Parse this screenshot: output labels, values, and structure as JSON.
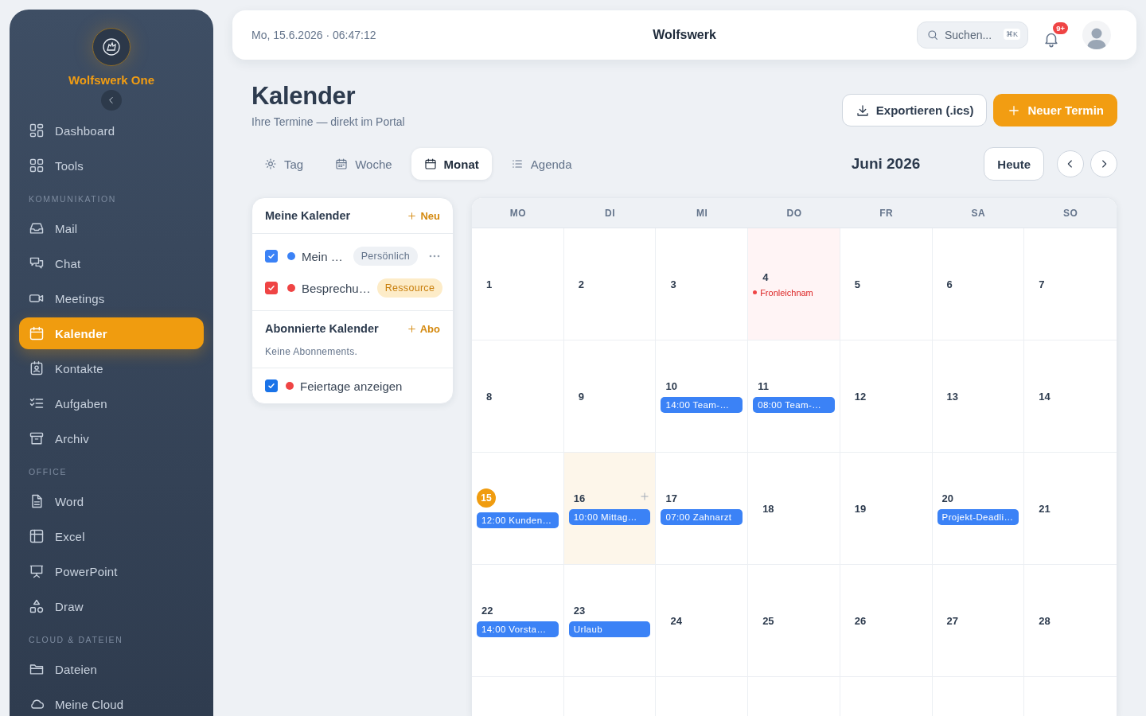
{
  "sidebar": {
    "brand": "Wolfswerk One",
    "sections": [
      {
        "items": [
          {
            "label": "Dashboard",
            "selected": false
          },
          {
            "label": "Tools",
            "selected": false
          }
        ]
      },
      {
        "heading": "KOMMUNIKATION",
        "items": [
          {
            "label": "Mail",
            "selected": false
          },
          {
            "label": "Chat",
            "selected": false
          },
          {
            "label": "Meetings",
            "selected": false
          },
          {
            "label": "Kalender",
            "selected": true
          },
          {
            "label": "Kontakte",
            "selected": false
          },
          {
            "label": "Aufgaben",
            "selected": false
          },
          {
            "label": "Archiv",
            "selected": false
          }
        ]
      },
      {
        "heading": "OFFICE",
        "items": [
          {
            "label": "Word",
            "selected": false
          },
          {
            "label": "Excel",
            "selected": false
          },
          {
            "label": "PowerPoint",
            "selected": false
          },
          {
            "label": "Draw",
            "selected": false
          }
        ]
      },
      {
        "heading": "CLOUD & DATEIEN",
        "items": [
          {
            "label": "Dateien",
            "selected": false
          },
          {
            "label": "Meine Cloud",
            "selected": false
          }
        ]
      }
    ]
  },
  "topbar": {
    "datetime": "Mo, 15.6.2026 · 06:47:12",
    "title": "Wolfswerk",
    "search": {
      "placeholder": "Suchen...",
      "shortcut": "⌘K"
    },
    "notifications": "9+"
  },
  "header": {
    "title": "Kalender",
    "subtitle": "Ihre Termine — direkt im Portal",
    "buttons": [
      {
        "label": "Exportieren (.ics)",
        "kind": "export"
      },
      {
        "label": "Neuer Termin",
        "kind": "primary"
      }
    ]
  },
  "views": [
    {
      "label": "Tag",
      "selected": false
    },
    {
      "label": "Woche",
      "selected": false
    },
    {
      "label": "Monat",
      "selected": true
    },
    {
      "label": "Agenda",
      "selected": false
    }
  ],
  "month": "Juni 2026",
  "today_button": "Heute",
  "calendars": {
    "title": "Meine Kalender",
    "add": "Neu",
    "items": [
      {
        "name": "Mein …",
        "color": "#3b82f6",
        "checked": true,
        "tag": "Persönlich",
        "kind": "personal",
        "show_menu": true
      },
      {
        "name": "Besprechu…",
        "color": "#ef4444",
        "checked": true,
        "tag": "Ressource",
        "kind": "resource",
        "show_menu": false
      }
    ],
    "subscribed": {
      "title": "Abonnierte Kalender",
      "add": "Abo",
      "empty": "Keine Abonnements."
    },
    "holidays": {
      "label": "Feiertage anzeigen",
      "checked": true,
      "color": "#ef4444"
    }
  },
  "grid": {
    "weekdays": [
      "MO",
      "DI",
      "MI",
      "DO",
      "FR",
      "SA",
      "SO"
    ],
    "weeks": [
      [
        {
          "day": "1"
        },
        {
          "day": "2"
        },
        {
          "day": "3"
        },
        {
          "day": "4",
          "holiday": "Fronleichnam"
        },
        {
          "day": "5"
        },
        {
          "day": "6"
        },
        {
          "day": "7"
        }
      ],
      [
        {
          "day": "8"
        },
        {
          "day": "9"
        },
        {
          "day": "10",
          "events": [
            "14:00 Team-…"
          ]
        },
        {
          "day": "11",
          "events": [
            "08:00 Team-…"
          ]
        },
        {
          "day": "12"
        },
        {
          "day": "13"
        },
        {
          "day": "14"
        }
      ],
      [
        {
          "day": "15",
          "today": true,
          "events": [
            "12:00 Kunden…"
          ]
        },
        {
          "day": "16",
          "hover": true,
          "events": [
            "10:00 Mittag…"
          ]
        },
        {
          "day": "17",
          "events": [
            "07:00 Zahnarzt"
          ]
        },
        {
          "day": "18"
        },
        {
          "day": "19"
        },
        {
          "day": "20",
          "events": [
            "Projekt-Deadli…"
          ]
        },
        {
          "day": "21"
        }
      ],
      [
        {
          "day": "22",
          "events": [
            "14:00 Vorsta…"
          ]
        },
        {
          "day": "23",
          "events": [
            "Urlaub"
          ]
        },
        {
          "day": "24"
        },
        {
          "day": "25"
        },
        {
          "day": "26"
        },
        {
          "day": "27"
        },
        {
          "day": "28"
        }
      ]
    ]
  }
}
